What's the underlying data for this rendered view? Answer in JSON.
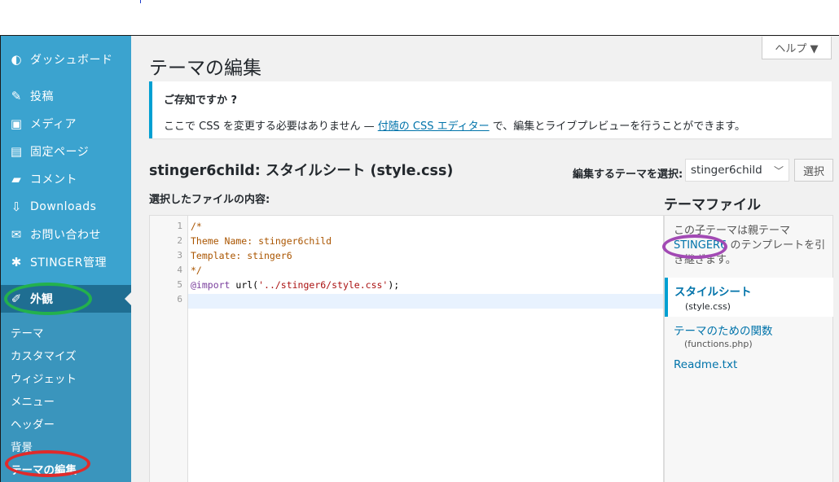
{
  "sidebar": {
    "items": [
      {
        "label": "ダッシュボード",
        "icon": "dashboard-icon",
        "glyph": "◐"
      },
      {
        "label": "投稿",
        "icon": "pin-icon",
        "glyph": "✎"
      },
      {
        "label": "メディア",
        "icon": "media-icon",
        "glyph": "▣"
      },
      {
        "label": "固定ページ",
        "icon": "page-icon",
        "glyph": "▤"
      },
      {
        "label": "コメント",
        "icon": "comment-icon",
        "glyph": "▰"
      },
      {
        "label": "Downloads",
        "icon": "download-icon",
        "glyph": "⇩"
      },
      {
        "label": "お問い合わせ",
        "icon": "mail-icon",
        "glyph": "✉"
      },
      {
        "label": "STINGER管理",
        "icon": "gear-icon",
        "glyph": "✱"
      }
    ],
    "appearance": {
      "label": "外観",
      "icon": "brush-icon",
      "glyph": "✐"
    },
    "submenu": [
      "テーマ",
      "カスタマイズ",
      "ウィジェット",
      "メニュー",
      "ヘッダー",
      "背景",
      "テーマの編集"
    ]
  },
  "header": {
    "help": "ヘルプ ▼",
    "title": "テーマの編集"
  },
  "notice": {
    "title": "ご存知ですか ?",
    "text_before": "ここで CSS を変更する必要はありません — ",
    "link": "付随の CSS エディター",
    "text_after": " で、編集とライブプレビューを行うことができます。"
  },
  "editor": {
    "file_theme": "stinger6child:",
    "file_name": "スタイルシート (style.css)",
    "select_label": "編集するテーマを選択:",
    "select_value": "stinger6child",
    "select_button": "選択",
    "content_label": "選択したファイルの内容:",
    "lines": [
      {
        "no": "1",
        "parts": [
          {
            "t": "/*",
            "c": "c-comment"
          }
        ]
      },
      {
        "no": "2",
        "parts": [
          {
            "t": "Theme Name: stinger6child",
            "c": "c-comment"
          }
        ]
      },
      {
        "no": "3",
        "parts": [
          {
            "t": "Template: stinger6",
            "c": "c-comment"
          }
        ]
      },
      {
        "no": "4",
        "parts": [
          {
            "t": "*/",
            "c": "c-comment"
          }
        ]
      },
      {
        "no": "5",
        "parts": [
          {
            "t": "@import",
            "c": "c-kw"
          },
          {
            "t": " url(",
            "c": "c-plain"
          },
          {
            "t": "'../stinger6/style.css'",
            "c": "c-str"
          },
          {
            "t": ");",
            "c": "c-plain"
          }
        ]
      },
      {
        "no": "6",
        "parts": []
      }
    ]
  },
  "theme_files": {
    "title": "テーマファイル",
    "desc_before": "この子テーマは親テーマ ",
    "parent_link": "STINGER6",
    "desc_after": " のテンプレートを引き継ぎます。",
    "files": [
      {
        "label": "スタイルシート",
        "sub": "(style.css)",
        "current": true
      },
      {
        "label": "テーマのための関数",
        "sub": "(functions.php)",
        "current": false
      },
      {
        "label": "Readme.txt",
        "sub": "",
        "current": false
      }
    ]
  },
  "colors": {
    "sidebar": "#3ba3cf",
    "sidebar_active": "#1f6e92",
    "accent": "#00a0d2",
    "link": "#0073aa",
    "highlight_green": "#23b14d",
    "highlight_red": "#e02b2b",
    "highlight_purple": "#a24ab4"
  }
}
